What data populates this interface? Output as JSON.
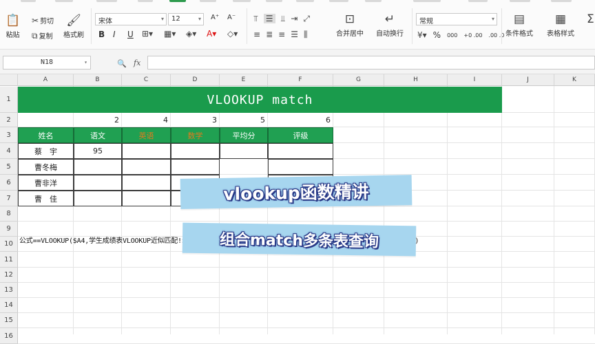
{
  "ribbon": {
    "clipboard": {
      "paste": "粘贴",
      "cut": "剪切",
      "copy": "复制",
      "format_painter": "格式刷"
    },
    "font": {
      "name": "宋体",
      "size": "12",
      "bold": "B",
      "italic": "I",
      "underline": "U",
      "grow": "A⁺",
      "shrink": "A⁻"
    },
    "alignment": {
      "merge_center": "合并居中",
      "wrap_text": "自动换行"
    },
    "number": {
      "format": "常规",
      "percent": "%",
      "comma": "000",
      "inc_decimal": "+.0 .00",
      "dec_decimal": ".00 →.0"
    },
    "styles": {
      "conditional": "条件格式",
      "table_style": "表格样式"
    }
  },
  "formula_bar": {
    "name_box": "N18",
    "fx": "fx",
    "formula": ""
  },
  "columns": [
    "A",
    "B",
    "C",
    "D",
    "E",
    "F",
    "G",
    "H",
    "I",
    "J",
    "K"
  ],
  "rows": [
    "1",
    "2",
    "3",
    "4",
    "5",
    "6",
    "7",
    "8",
    "9",
    "10",
    "11",
    "12",
    "13",
    "14",
    "15",
    "16"
  ],
  "sheet": {
    "title": "VLOOKUP match",
    "row2_numbers": [
      "2",
      "4",
      "3",
      "5",
      "6"
    ],
    "headers": [
      "姓名",
      "语文",
      "英语",
      "数学",
      "平均分",
      "评级"
    ],
    "names": [
      "蔡　宇",
      "曹冬梅",
      "曹非洋",
      "曹　佳"
    ],
    "b4_value": "95",
    "formula_text": "公式==VLOOKUP($A4,学生成绩表VLOOKUP近似匹配!$A$3:$F$24,MATCH(B$3,学生成绩表VLOOKUP近似匹配!$A$3:$F$3,0),0)"
  },
  "overlay": {
    "banner1": "vlookup函数精讲",
    "banner2": "组合match多条表查询"
  },
  "colors": {
    "title_bg": "#1a9b4c",
    "header_bg": "#20a052",
    "header_orange_text": "#e07a1f",
    "banner_bg": "#a7d6ef"
  }
}
